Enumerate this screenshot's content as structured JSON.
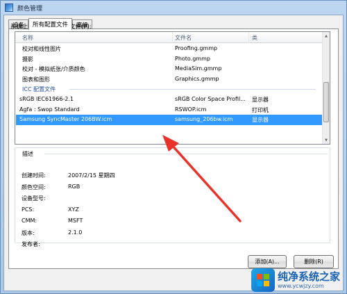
{
  "window": {
    "title": "颜色管理",
    "icon": "color-management-icon"
  },
  "tabs": [
    {
      "label": "设备",
      "active": false
    },
    {
      "label": "所有配置文件",
      "active": true
    },
    {
      "label": "高级",
      "active": false
    }
  ],
  "profiles": {
    "caption": "系统上安装了下列配置文件(P):",
    "columns": {
      "name": "名称",
      "file": "文件名",
      "type": "类"
    },
    "rows": [
      {
        "name": "校对和线性图片",
        "file": "Proofing.gmmp",
        "type": ""
      },
      {
        "name": "摄影",
        "file": "Photo.gmmp",
        "type": ""
      },
      {
        "name": "校对 - 模拟纸张/介质颜色",
        "file": "MediaSim.gmmp",
        "type": ""
      },
      {
        "name": "图表和图形",
        "file": "Graphics.gmmp",
        "type": ""
      },
      {
        "group": "ICC 配置文件"
      },
      {
        "name": "sRGB IEC61966-2.1",
        "file": "sRGB Color Space Profil...",
        "type": "显示器"
      },
      {
        "name": "Agfa : Swop Standard",
        "file": "RSWOP.icm",
        "type": "打印机"
      },
      {
        "name": "Samsung SyncMaster 206BW.icm",
        "file": "samsung_206bw.icm",
        "type": "显示器",
        "selected": true
      }
    ]
  },
  "details": {
    "legend": "描述",
    "properties": [
      {
        "label": "创建时间:",
        "value": "2007/2/15 星期四"
      },
      {
        "label": "颜色空间:",
        "value": "RGB"
      },
      {
        "label": "设备型号:",
        "value": ""
      },
      {
        "label": "PCS:",
        "value": "XYZ"
      },
      {
        "label": "CMM:",
        "value": "MSFT"
      },
      {
        "label": "版本:",
        "value": "2.1.0"
      },
      {
        "label": "发布者:",
        "value": ""
      }
    ]
  },
  "buttons": {
    "add": "添加(A)...",
    "remove": "删除(R)"
  },
  "watermark": {
    "title": "纯净系统之家",
    "url": "www.ycwjzy.com"
  },
  "colors": {
    "selection": "#3399ff",
    "annotation_arrow": "#e8332a",
    "group_header": "#1e4fa3"
  }
}
